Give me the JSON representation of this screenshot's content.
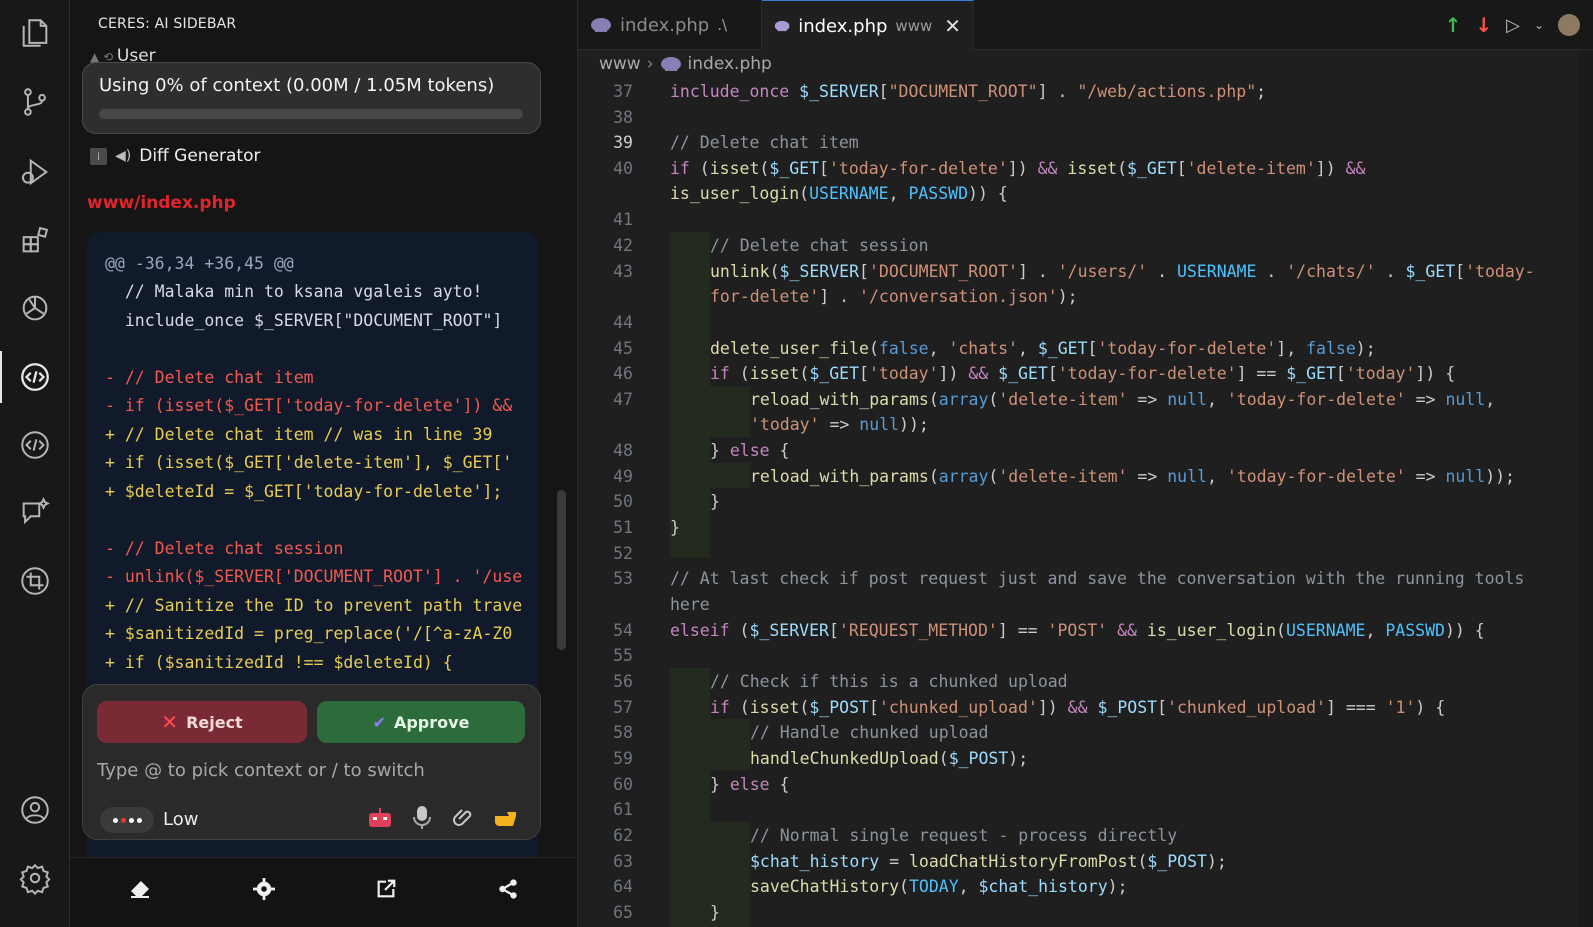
{
  "colors": {
    "background": "#1f1f1f",
    "sidebar": "#151515",
    "reject": "#7a2a35",
    "approve": "#2e6b3a",
    "file_link": "#e0242b",
    "diff_delete": "#f25a4f",
    "diff_add": "#e8cc56"
  },
  "activity_bar": {
    "icons": [
      "explorer-icon",
      "source-control-icon",
      "run-debug-icon",
      "extensions-icon",
      "openai-icon",
      "code-assistant-icon",
      "code-assistant-alt-icon",
      "chat-sparkle-icon",
      "crop-icon",
      "account-icon",
      "settings-gear-icon"
    ],
    "active": "code-assistant-icon"
  },
  "sidebar": {
    "title": "CERES: AI SIDEBAR",
    "user_label": "User",
    "context_usage": "Using 0% of context (0.00M / 1.05M tokens)",
    "section_title": "Diff Generator",
    "file_link": "www/index.php",
    "diff_lines": [
      {
        "type": "hunk",
        "text": "@@ -36,34 +36,45 @@"
      },
      {
        "type": "ctx",
        "text": "  // Malaka min to ksana vgaleis ayto!"
      },
      {
        "type": "ctx",
        "text": "  include_once $_SERVER[\"DOCUMENT_ROOT\"]"
      },
      {
        "type": "ctx",
        "text": ""
      },
      {
        "type": "del",
        "text": "- // Delete chat item"
      },
      {
        "type": "del",
        "text": "- if (isset($_GET['today-for-delete']) &&"
      },
      {
        "type": "add",
        "text": "+ // Delete chat item // was in line 39"
      },
      {
        "type": "add",
        "text": "+ if (isset($_GET['delete-item'], $_GET['"
      },
      {
        "type": "add",
        "text": "+ $deleteId = $_GET['today-for-delete'];"
      },
      {
        "type": "ctx",
        "text": ""
      },
      {
        "type": "del",
        "text": "- // Delete chat session"
      },
      {
        "type": "del",
        "text": "- unlink($_SERVER['DOCUMENT_ROOT'] . '/use"
      },
      {
        "type": "add",
        "text": "+ // Sanitize the ID to prevent path trave"
      },
      {
        "type": "add",
        "text": "+ $sanitizedId = preg_replace('/[^a-zA-Z0"
      },
      {
        "type": "add",
        "text": "+ if ($sanitizedId !== $deleteId) {"
      }
    ],
    "reject_label": "Reject",
    "approve_label": "Approve",
    "prompt_placeholder": "Type @ to pick context or / to switch",
    "effort_label": "Low",
    "tool_icons": [
      "robot-icon",
      "microphone-icon",
      "paperclip-icon",
      "pointing-hand-icon"
    ],
    "bottom_icons": [
      "eraser-icon",
      "settings-icon",
      "open-external-icon",
      "share-icon"
    ]
  },
  "editor": {
    "tabs": [
      {
        "label": "index.php",
        "description": ".\\",
        "active": false
      },
      {
        "label": "index.php",
        "description": "www",
        "active": true
      }
    ],
    "actions": [
      "arrow-up-icon",
      "arrow-down-icon",
      "run-icon",
      "chevron-down-icon",
      "avatar"
    ],
    "breadcrumbs": [
      "www",
      "index.php"
    ],
    "line_numbers": [
      "37",
      "38",
      "39",
      "40",
      "",
      "41",
      "42",
      "43",
      "",
      "44",
      "45",
      "46",
      "47",
      "",
      "48",
      "49",
      "50",
      "51",
      "52",
      "53",
      "",
      "54",
      "55",
      "56",
      "57",
      "58",
      "59",
      "60",
      "61",
      "62",
      "63",
      "64",
      "65"
    ],
    "current_line": "39"
  }
}
